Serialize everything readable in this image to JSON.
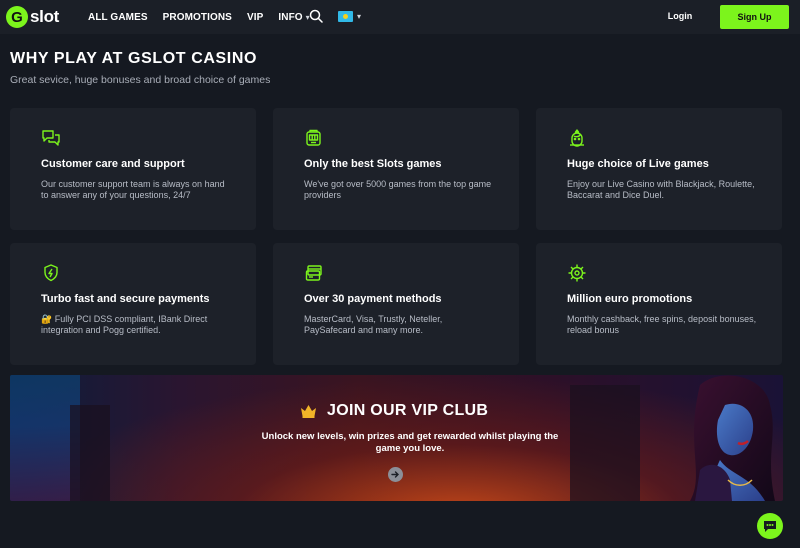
{
  "header": {
    "logo_letter": "G",
    "logo_text": "slot",
    "nav": [
      {
        "label": "ALL GAMES"
      },
      {
        "label": "PROMOTIONS"
      },
      {
        "label": "VIP"
      },
      {
        "label": "INFO"
      }
    ],
    "search_icon": "search-icon",
    "language_flag": "kazakhstan-flag-icon",
    "login_label": "Login",
    "signup_label": "Sign Up"
  },
  "section": {
    "title": "WHY PLAY AT GSLOT CASINO",
    "subtitle": "Great sevice, huge bonuses and broad choice of games"
  },
  "features": [
    {
      "icon": "chat-bubbles-icon",
      "title": "Customer care and support",
      "text": "Our customer support team is always on hand to answer any of your questions, 24/7"
    },
    {
      "icon": "slot-machine-icon",
      "title": "Only the best Slots games",
      "text": "We've got over 5000 games from the top game providers"
    },
    {
      "icon": "live-dealer-icon",
      "title": "Huge choice of Live games",
      "text": "Enjoy our Live Casino with Blackjack, Roulette, Baccarat and Dice Duel."
    },
    {
      "icon": "shield-bolt-icon",
      "title": "Turbo fast and secure payments",
      "text": "🔐 Fully PCI DSS compliant, IBank Direct integration and Pogg certified."
    },
    {
      "icon": "payment-card-icon",
      "title": "Over 30 payment methods",
      "text": "MasterCard, Visa, Trustly, Neteller, PaySafecard and many more."
    },
    {
      "icon": "promo-badge-icon",
      "title": "Million euro promotions",
      "text": "Monthly cashback, free spins, deposit bonuses, reload bonus"
    }
  ],
  "vip_banner": {
    "title": "JOIN OUR VIP CLUB",
    "text": "Unlock new levels, win prizes and get rewarded whilst playing the game you love.",
    "crown_icon": "crown-icon",
    "arrow_icon": "arrow-right-icon"
  },
  "chat_icon": "chat-icon",
  "colors": {
    "accent": "#7cf41c",
    "background": "#151921",
    "card": "#1d2129",
    "header": "#1b1f27"
  }
}
